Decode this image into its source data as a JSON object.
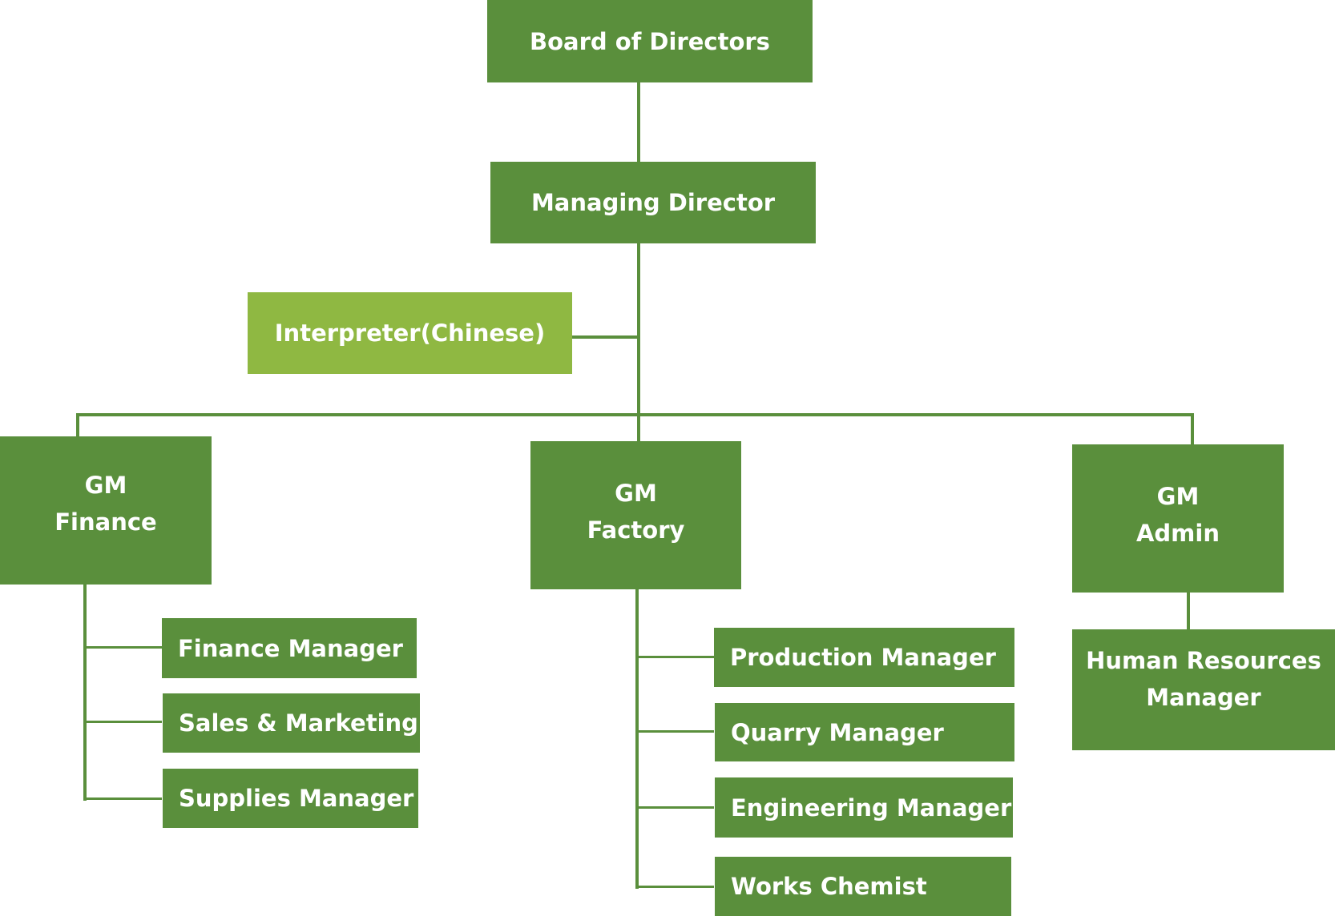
{
  "colors": {
    "primary": "#5a8f3c",
    "secondary": "#8fb842",
    "text": "#ffffff"
  },
  "org_chart": {
    "board": "Board of Directors",
    "managing_director": "Managing Director",
    "interpreter": "Interpreter(Chinese)",
    "gm_finance": {
      "title": "GM\nFinance",
      "reports": [
        "Finance Manager",
        "Sales & Marketing",
        "Supplies Manager"
      ]
    },
    "gm_factory": {
      "title": "GM\nFactory",
      "reports": [
        "Production Manager",
        "Quarry Manager",
        "Engineering Manager",
        "Works Chemist"
      ]
    },
    "gm_admin": {
      "title": "GM\nAdmin",
      "reports": [
        "Human Resources\nManager"
      ]
    }
  }
}
